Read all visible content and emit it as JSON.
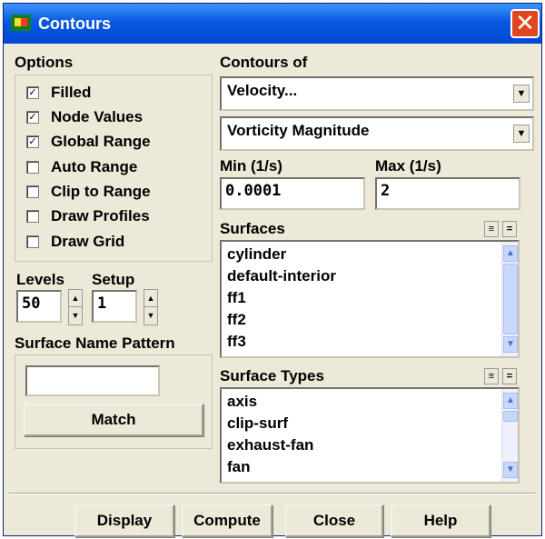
{
  "window": {
    "title": "Contours",
    "close_glyph": "✕"
  },
  "options": {
    "header": "Options",
    "checkboxes": [
      {
        "label": "Filled",
        "checked": true
      },
      {
        "label": "Node Values",
        "checked": true
      },
      {
        "label": "Global Range",
        "checked": true
      },
      {
        "label": "Auto Range",
        "checked": false
      },
      {
        "label": "Clip to Range",
        "checked": false
      },
      {
        "label": "Draw Profiles",
        "checked": false
      },
      {
        "label": "Draw Grid",
        "checked": false
      }
    ],
    "check_glyph": "✓"
  },
  "levels": {
    "label": "Levels",
    "value": "50"
  },
  "setup": {
    "label": "Setup",
    "value": "1"
  },
  "surface_name_pattern": {
    "label": "Surface Name Pattern",
    "value": "",
    "match_button": "Match"
  },
  "contours_of": {
    "label": "Contours of",
    "category": "Velocity...",
    "quantity": "Vorticity Magnitude"
  },
  "min": {
    "label": "Min (1/s)",
    "value": "0.0001"
  },
  "max": {
    "label": "Max (1/s)",
    "value": "2"
  },
  "surfaces": {
    "label": "Surfaces",
    "items": [
      "cylinder",
      "default-interior",
      "ff1",
      "ff2",
      "ff3"
    ]
  },
  "surface_types": {
    "label": "Surface Types",
    "items": [
      "axis",
      "clip-surf",
      "exhaust-fan",
      "fan"
    ]
  },
  "buttons": {
    "display": "Display",
    "compute": "Compute",
    "close": "Close",
    "help": "Help"
  },
  "colors": {
    "titlebar": "#0a58e0",
    "window_bg": "#ece9d8",
    "close_button": "#e0451f"
  },
  "icons": {
    "dropdown": "down-arrow-icon",
    "spin_up": "up-arrow-icon",
    "spin_down": "down-arrow-icon",
    "scroll_up": "up-arrow-icon",
    "scroll_down": "down-arrow-icon"
  }
}
